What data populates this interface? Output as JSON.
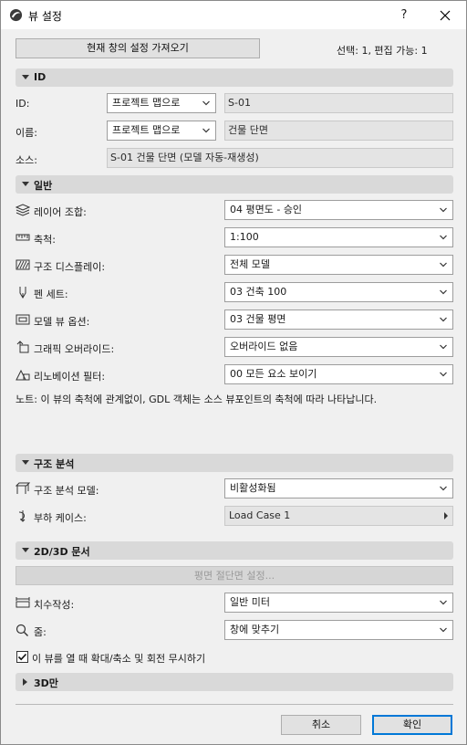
{
  "window": {
    "title": "뷰 설정",
    "help_label": "?"
  },
  "top": {
    "fetch_button": "현재 창의 설정 가져오기",
    "selection_info": "선택: 1, 편집 가능: 1"
  },
  "id_section": {
    "title": "ID",
    "id_label": "ID:",
    "id_source": "프로젝트 맵으로",
    "id_value": "S-01",
    "name_label": "이름:",
    "name_source": "프로젝트 맵으로",
    "name_value": "건물 단면",
    "source_label": "소스:",
    "source_value": "S-01 건물 단면 (모델 자동-재생성)"
  },
  "general_section": {
    "title": "일반",
    "rows": [
      {
        "label": "레이어 조합:",
        "value": "04 평면도 - 승인",
        "icon": "layers-icon"
      },
      {
        "label": "축척:",
        "value": "1:100",
        "icon": "scale-ruler-icon"
      },
      {
        "label": "구조 디스플레이:",
        "value": "전체 모델",
        "icon": "structure-display-icon"
      },
      {
        "label": "펜 세트:",
        "value": "03 건축 100",
        "icon": "pen-icon"
      },
      {
        "label": "모델 뷰 옵션:",
        "value": "03 건물 평면",
        "icon": "model-view-icon"
      },
      {
        "label": "그래픽 오버라이드:",
        "value": "오버라이드 없음",
        "icon": "graphic-override-icon"
      },
      {
        "label": "리노베이션 필터:",
        "value": "00 모든 요소 보이기",
        "icon": "renovation-filter-icon"
      }
    ],
    "note": "노트: 이 뷰의 축척에 관계없이, GDL 객체는 소스 뷰포인트의 축척에 따라 나타납니다."
  },
  "structural_section": {
    "title": "구조 분석",
    "model_label": "구조 분석 모델:",
    "model_value": "비활성화됨",
    "load_label": "부하 케이스:",
    "load_value": "Load Case 1"
  },
  "docs_section": {
    "title": "2D/3D 문서",
    "plan_cut_button": "평면 절단면 설정...",
    "dimension_label": "치수작성:",
    "dimension_value": "일반 미터",
    "zoom_label": "줌:",
    "zoom_value": "창에 맞추기",
    "ignore_zoom_label": "이 뷰를 열 때 확대/축소 및 회전 무시하기",
    "ignore_zoom_checked": true
  },
  "only3d_section": {
    "title": "3D만"
  },
  "footer": {
    "cancel": "취소",
    "ok": "확인"
  }
}
